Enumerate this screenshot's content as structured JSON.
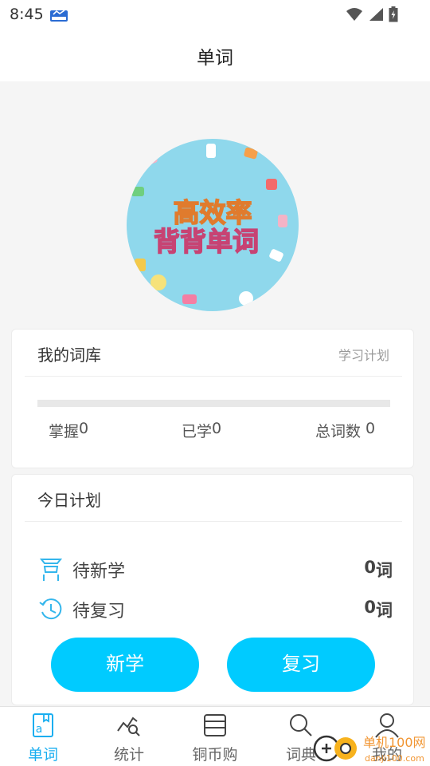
{
  "status_bar": {
    "time": "8:45"
  },
  "header": {
    "title": "单词"
  },
  "banner": {
    "line1": "高效率",
    "line2": "背背单词"
  },
  "vocab_card": {
    "title": "我的词库",
    "link": "学习计划",
    "progress_fraction": 0,
    "mastered_label": "掌握",
    "mastered_value": "0",
    "learned_label": "已学",
    "learned_value": "0",
    "total_label": "总词数 ",
    "total_value": "0"
  },
  "plan_card": {
    "title": "今日计划",
    "new_label": "待新学",
    "new_value": "0",
    "new_unit": "词",
    "review_label": "待复习",
    "review_value": "0",
    "review_unit": "词",
    "new_button": "新学",
    "review_button": "复习"
  },
  "tabs": [
    {
      "label": "单词",
      "icon": "word-book-icon",
      "active": true
    },
    {
      "label": "统计",
      "icon": "stats-chart-icon",
      "active": false
    },
    {
      "label": "铜币购",
      "icon": "card-icon",
      "active": false
    },
    {
      "label": "词典",
      "icon": "search-icon",
      "active": false
    },
    {
      "label": "我的",
      "icon": "user-icon",
      "active": false
    }
  ],
  "watermark": {
    "text": "单机100网",
    "sub": "danji100.com"
  },
  "colors": {
    "accent": "#00cbff",
    "tab_active": "#19aef0",
    "background": "#f5f5f5"
  }
}
